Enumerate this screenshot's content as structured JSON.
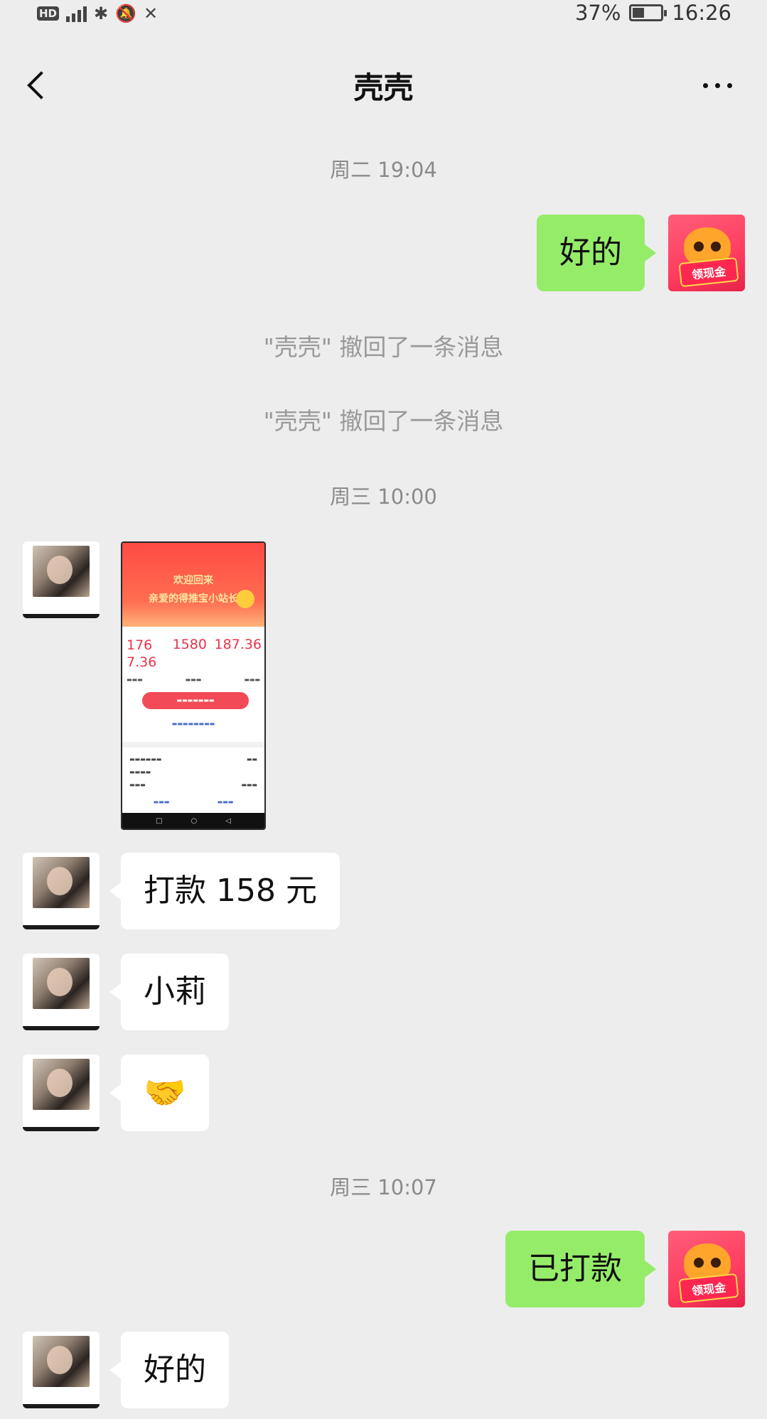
{
  "status": {
    "hd": "HD",
    "network": "4G",
    "battery_percent": "37%",
    "battery_level": 0.37,
    "time": "16:26"
  },
  "header": {
    "title": "壳壳"
  },
  "timestamps": [
    "周二 19:04",
    "周三 10:00",
    "周三 10:07"
  ],
  "system_notices": [
    "\"壳壳\" 撤回了一条消息",
    "\"壳壳\" 撤回了一条消息"
  ],
  "messages": [
    {
      "side": "right",
      "text": "好的"
    },
    {
      "side": "left",
      "type": "image"
    },
    {
      "side": "left",
      "text": "打款 158 元"
    },
    {
      "side": "left",
      "text": "小莉"
    },
    {
      "side": "left",
      "text": "🤝"
    },
    {
      "side": "right",
      "text": "已打款"
    },
    {
      "side": "left",
      "text": "好的"
    }
  ],
  "avatars": {
    "right_badge": "领现金"
  },
  "shared_image": {
    "line1": "欢迎回来",
    "line2": "亲爱的得推宝小站长",
    "stat1": "1767.36",
    "stat2": "1580",
    "stat3": "187.36"
  },
  "colors": {
    "background": "#ededed",
    "sent_bubble": "#95ec69",
    "received_bubble": "#ffffff"
  },
  "icons": [
    "back-arrow-icon",
    "more-dots-icon",
    "signal-icon",
    "bluetooth-icon",
    "mute-icon",
    "battery-icon"
  ]
}
